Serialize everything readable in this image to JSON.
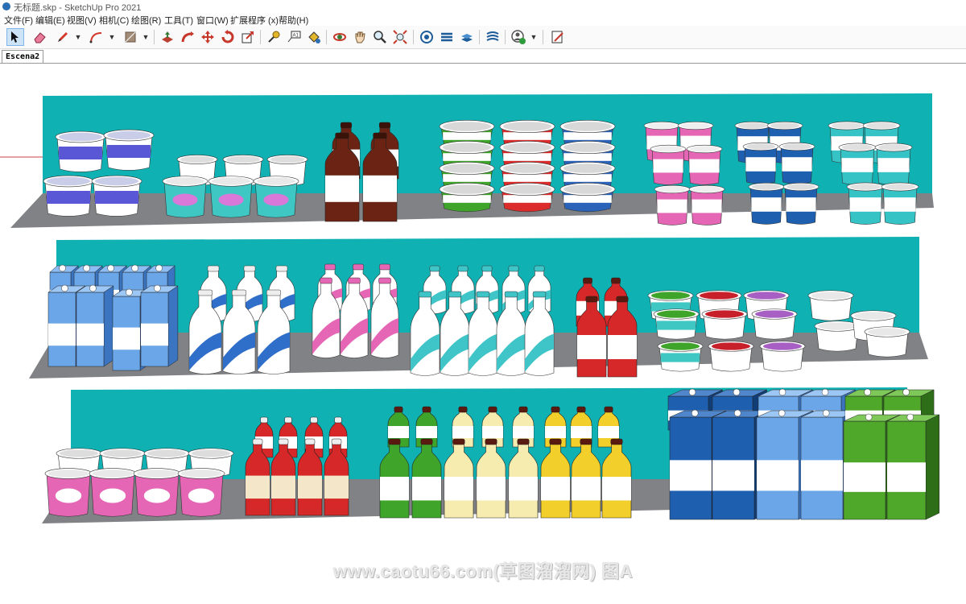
{
  "window": {
    "title": "无标题.skp - SketchUp Pro 2021"
  },
  "menu": [
    "文件(F)",
    "编辑(E)",
    "视图(V)",
    "相机(C)",
    "绘图(R)",
    "工具(T)",
    "窗口(W)",
    "扩展程序 (x)",
    "帮助(H)"
  ],
  "toolbar": {
    "tools": [
      "select-tool",
      "eraser-tool",
      "line-tool",
      "arc-tool",
      "shape-tool",
      "push-pull-tool",
      "follow-me-tool",
      "move-tool",
      "rotate-tool",
      "scale-tool",
      "tape-measure-tool",
      "text-tool",
      "paint-bucket-tool",
      "orbit-tool",
      "pan-tool",
      "zoom-tool",
      "zoom-extents-tool",
      "warehouse-tool",
      "extension-warehouse-tool",
      "layout-tool",
      "sandbox-tool",
      "account-tool",
      "extension-manager-tool"
    ]
  },
  "scene_tab": {
    "label": "Escena2"
  },
  "colors": {
    "shelf_back": "#0fb1b3",
    "shelf_floor": "#808285",
    "selection": "#cde4f7"
  },
  "watermark": "www.caotu66.com(草图溜溜网) 图A"
}
